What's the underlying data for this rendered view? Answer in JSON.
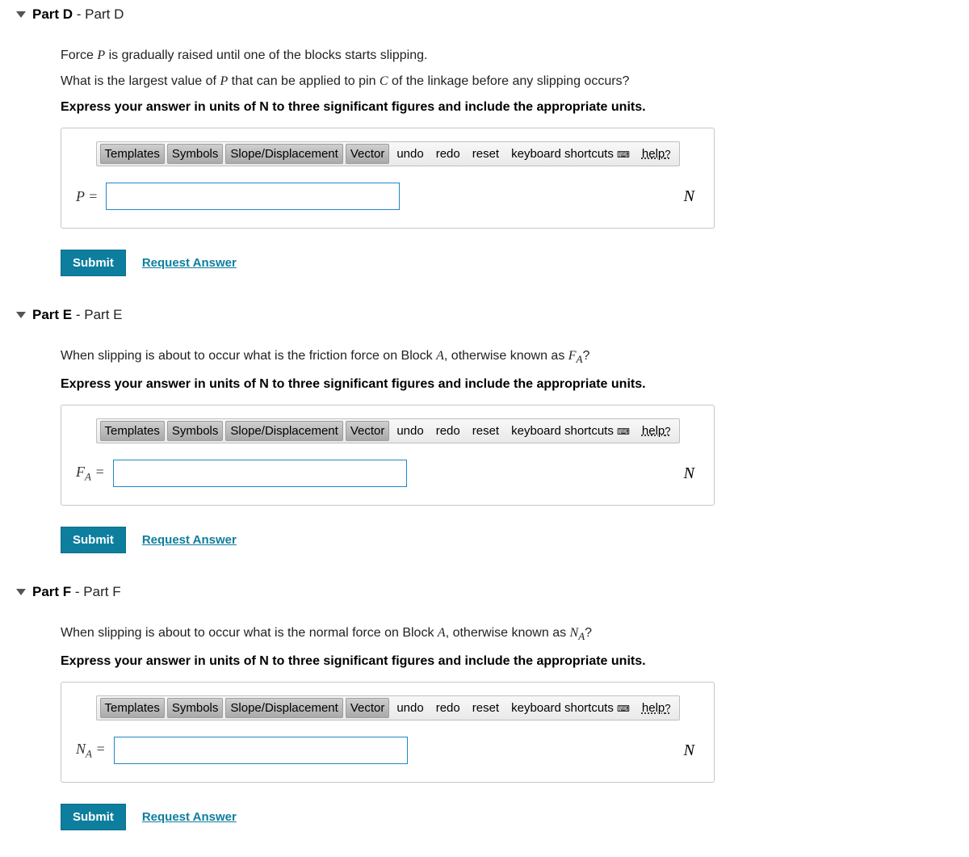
{
  "common": {
    "toolbar": {
      "templates": "Templates",
      "symbols": "Symbols",
      "slope": "Slope/Displacement",
      "vector": "Vector",
      "undo": "undo",
      "redo": "redo",
      "reset": "reset",
      "keyboard_shortcuts": "keyboard shortcuts",
      "help": "help"
    },
    "submit": "Submit",
    "request_answer": "Request Answer",
    "instruction_units": "Express your answer in units of N to three significant figures and include the appropriate units.",
    "unit": "N"
  },
  "partD": {
    "header_bold": "Part D",
    "header_plain": " - Part D",
    "line1_a": "Force ",
    "line1_var": "P",
    "line1_b": " is gradually raised until one of the blocks starts slipping.",
    "line2_a": "What is the largest value of ",
    "line2_var1": "P",
    "line2_b": " that can be applied to pin ",
    "line2_var2": "C",
    "line2_c": " of the linkage before any slipping occurs?",
    "lhs": "P",
    "value": ""
  },
  "partE": {
    "header_bold": "Part E",
    "header_plain": " - Part E",
    "q_a": "When slipping is about to occur what is the friction force on Block ",
    "q_var1": "A",
    "q_b": ", otherwise known as ",
    "q_var2_main": "F",
    "q_var2_sub": "A",
    "q_c": "?",
    "lhs_main": "F",
    "lhs_sub": "A",
    "value": ""
  },
  "partF": {
    "header_bold": "Part F",
    "header_plain": " - Part F",
    "q_a": "When slipping is about to occur what is the normal force on Block ",
    "q_var1": "A",
    "q_b": ", otherwise known as ",
    "q_var2_main": "N",
    "q_var2_sub": "A",
    "q_c": "?",
    "lhs_main": "N",
    "lhs_sub": "A",
    "value": ""
  }
}
